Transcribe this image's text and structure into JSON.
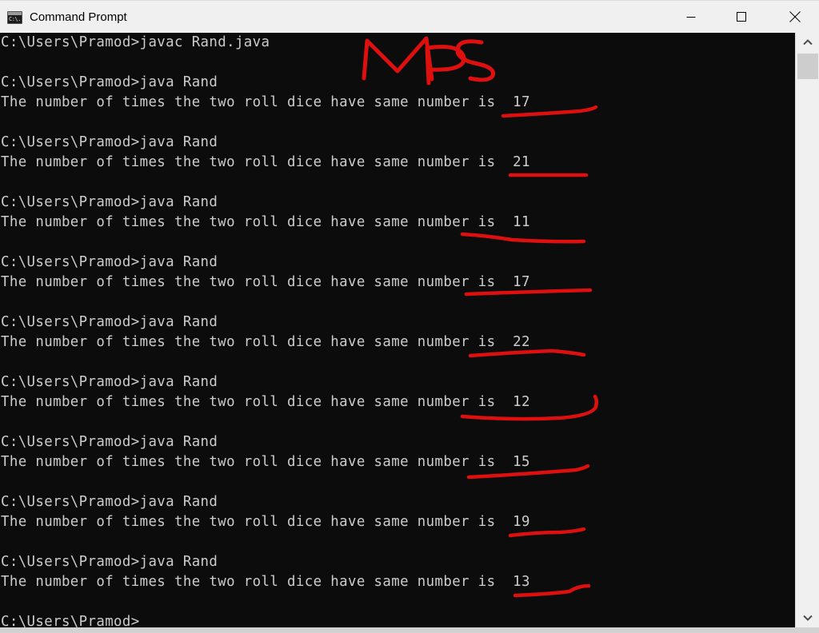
{
  "window": {
    "title": "Command Prompt",
    "icon": "console-icon",
    "icon_text": "C:\\.",
    "background": "#0c0c0c",
    "foreground": "#cccccc",
    "titlebar_background": "#f0f0f0",
    "controls": {
      "minimize": "minimize-button",
      "maximize": "maximize-button",
      "close": "close-button"
    }
  },
  "terminal": {
    "prompt": "C:\\Users\\Pramod>",
    "lines": [
      "C:\\Users\\Pramod>javac Rand.java",
      "",
      "C:\\Users\\Pramod>java Rand",
      "The number of times the two roll dice have same number is  17",
      "",
      "C:\\Users\\Pramod>java Rand",
      "The number of times the two roll dice have same number is  21",
      "",
      "C:\\Users\\Pramod>java Rand",
      "The number of times the two roll dice have same number is  11",
      "",
      "C:\\Users\\Pramod>java Rand",
      "The number of times the two roll dice have same number is  17",
      "",
      "C:\\Users\\Pramod>java Rand",
      "The number of times the two roll dice have same number is  22",
      "",
      "C:\\Users\\Pramod>java Rand",
      "The number of times the two roll dice have same number is  12",
      "",
      "C:\\Users\\Pramod>java Rand",
      "The number of times the two roll dice have same number is  15",
      "",
      "C:\\Users\\Pramod>java Rand",
      "The number of times the two roll dice have same number is  19",
      "",
      "C:\\Users\\Pramod>java Rand",
      "The number of times the two roll dice have same number is  13",
      "",
      "C:\\Users\\Pramod>"
    ],
    "compile_command": "javac Rand.java",
    "run_command": "java Rand",
    "output_message": "The number of times the two roll dice have same number is",
    "results": [
      17,
      21,
      11,
      17,
      22,
      12,
      15,
      19,
      13
    ]
  },
  "annotations": {
    "ink_color": "#dd0f0f",
    "handwriting": "MPS",
    "underline_count": 9,
    "note": "handwritten red marker annotation over console output"
  },
  "scrollbar": {
    "up_arrow": "chevron-up-icon",
    "down_arrow": "chevron-down-icon",
    "thumb": "scrollbar-thumb"
  }
}
